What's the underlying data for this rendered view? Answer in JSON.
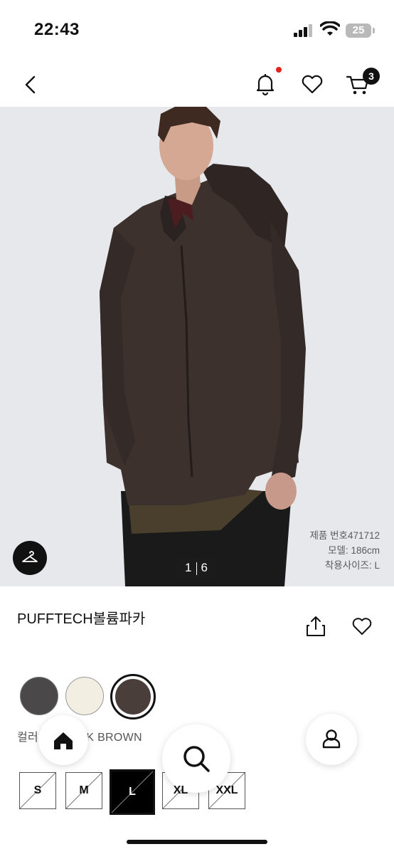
{
  "status_bar": {
    "time": "22:43",
    "battery": "25"
  },
  "header": {
    "cart_count": "3"
  },
  "hero": {
    "page_current": "1",
    "page_total": "6",
    "product_no": "제품 번호471712",
    "model_height": "모델: 186cm",
    "worn_size": "착용사이즈: L"
  },
  "product": {
    "title": "PUFFTECH볼륨파카",
    "color_label": "컬러: 38 DARK BROWN",
    "swatches": [
      "#4a4848",
      "#f3eee2",
      "#4a3e3b"
    ]
  },
  "sizes": [
    {
      "label": "S",
      "available": false
    },
    {
      "label": "M",
      "available": false
    },
    {
      "label": "L",
      "available": false,
      "selected": true
    },
    {
      "label": "XL",
      "available": false
    },
    {
      "label": "XXL",
      "available": false
    }
  ],
  "nav": {
    "items": [
      "home-icon",
      "search-icon",
      "user-icon"
    ]
  },
  "colors": {
    "accent": "#111111",
    "notification_dot": "#e2231a"
  }
}
